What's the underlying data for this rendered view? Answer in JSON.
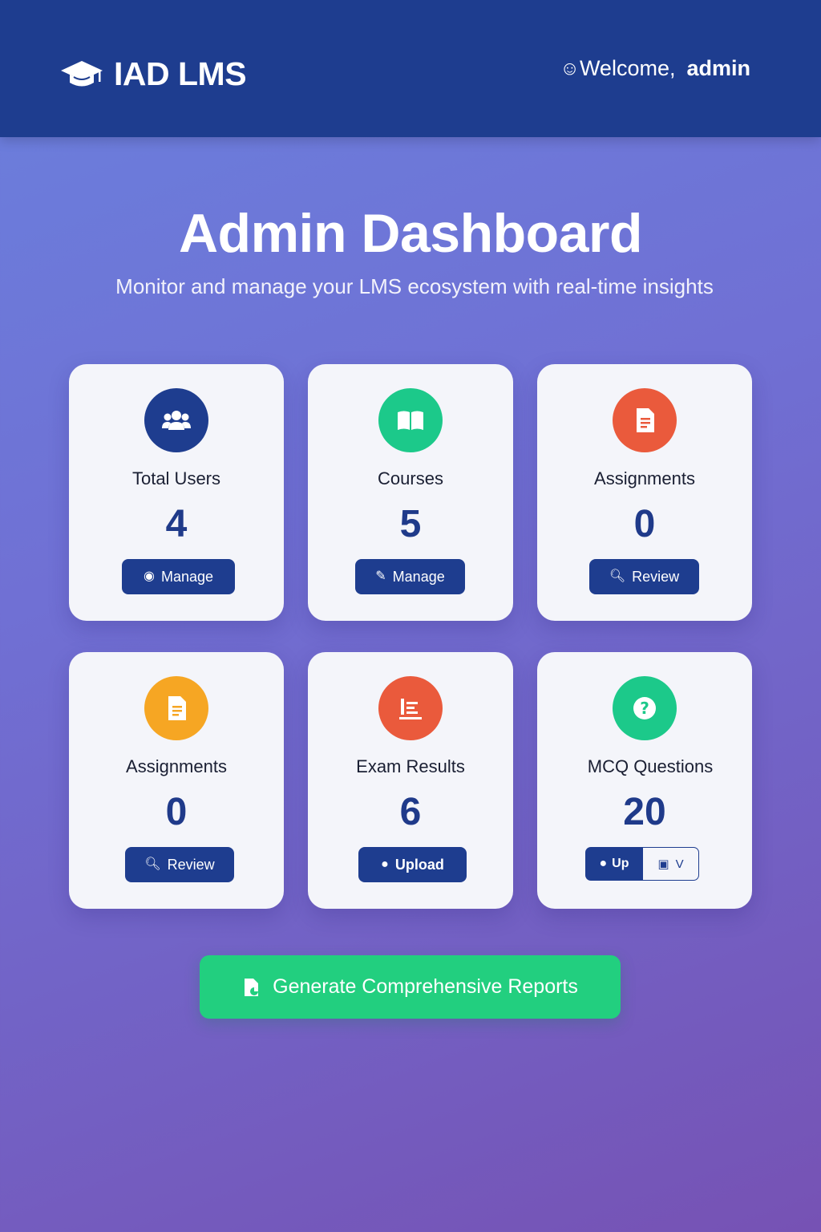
{
  "app": {
    "title": "IAD LMS",
    "logo_icon": "graduation-cap-icon"
  },
  "header": {
    "welcome_icon": "user-icon",
    "welcome_text": "Welcome,",
    "username": "admin"
  },
  "hero": {
    "title": "Admin Dashboard",
    "subtitle": "Monitor and manage your LMS ecosystem with real-time insights"
  },
  "colors": {
    "navbar": "#1e3d8f",
    "button": "#1e3d8f",
    "count": "#1f3a8a",
    "users_icon_bg": "#1e3d8f",
    "courses_icon_bg": "#1cc98a",
    "assignments_icon_bg": "#ea5a3c",
    "assignments2_icon_bg": "#f6a623",
    "exam_icon_bg": "#ea5a3c",
    "mcq_icon_bg": "#1cc98a",
    "generate_bg": "#22cf7f"
  },
  "cards": [
    {
      "label": "Total Users",
      "count": "4",
      "icon": "users-icon",
      "button": "Manage",
      "button_icon": "user-shield-icon"
    },
    {
      "label": "Courses",
      "count": "5",
      "icon": "book-icon",
      "button": "Manage",
      "button_icon": "edit-icon"
    },
    {
      "label": "Assignments",
      "count": "0",
      "icon": "file-icon",
      "button": "Review",
      "button_icon": "search-icon"
    },
    {
      "label": "Assignments",
      "count": "0",
      "icon": "file-icon",
      "button": "Review",
      "button_icon": "search-icon"
    },
    {
      "label": "Exam Results",
      "count": "6",
      "icon": "results-icon",
      "button": "Upload",
      "button_icon": "user-icon"
    },
    {
      "label": "MCQ Questions",
      "count": "20",
      "icon": "question-icon",
      "button": "Up",
      "button_icon": "user-icon",
      "secondary_button": "V",
      "secondary_icon": "view-icon"
    }
  ],
  "generate": {
    "label": "Generate Comprehensive Reports",
    "icon": "report-icon"
  }
}
